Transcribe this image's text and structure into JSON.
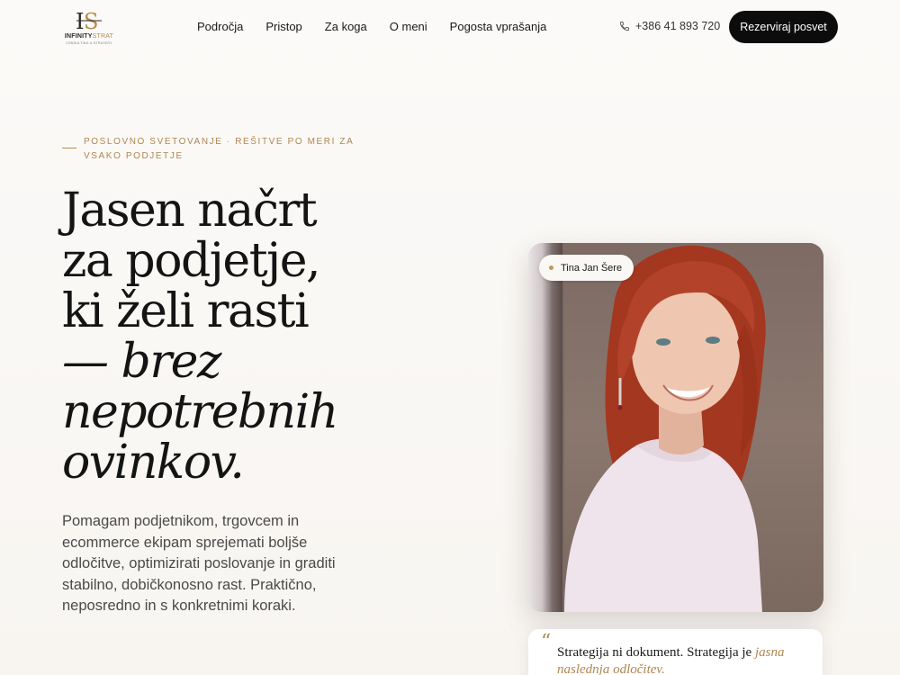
{
  "brand": {
    "monogram": "IS",
    "name_part1": "INFINITY",
    "name_part2": "STRAT",
    "tagline": "CONSULTING & STRATEGY",
    "accent_color": "#b08650"
  },
  "nav": {
    "items": [
      {
        "label": "Področja"
      },
      {
        "label": "Pristop"
      },
      {
        "label": "Za koga"
      },
      {
        "label": "O meni"
      },
      {
        "label": "Pogosta vprašanja"
      }
    ]
  },
  "contact": {
    "phone_icon": "phone-icon",
    "phone": "+386 41 893 720"
  },
  "cta": {
    "label": "Rezerviraj posvet"
  },
  "hero": {
    "eyebrow": "POSLOVNO SVETOVANJE · REŠITVE PO MERI ZA VSAKO PODJETJE",
    "headline": {
      "line1": "Jasen načrt",
      "line2": "za podjetje,",
      "line3": "ki želi rasti",
      "line4": "— brez",
      "line5": "nepotrebnih",
      "line6": "ovinkov."
    },
    "lead": "Pomagam podjetnikom, trgovcem in ecommerce ekipam sprejemati boljše odločitve, optimizirati poslovanje in graditi stabilno, dobičkonosno rast. Praktično, neposredno in s konkretnimi koraki."
  },
  "portrait": {
    "name_badge": "Tina Jan Šere"
  },
  "quote": {
    "mark": "“",
    "text_plain": "Strategija ni dokument. Strategija je ",
    "text_accent": "jasna naslednja odločitev."
  }
}
